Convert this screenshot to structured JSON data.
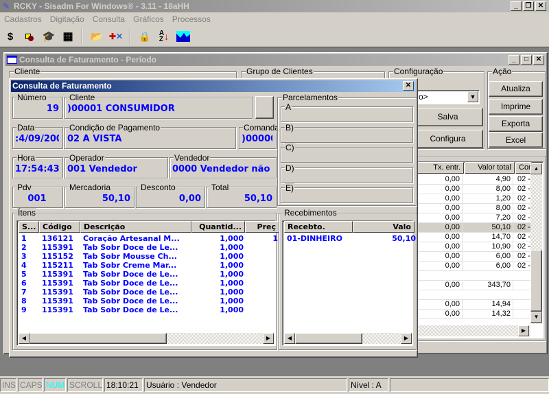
{
  "app": {
    "title": "RCKY - Sisadm For Windows® - 3.11 - 18aHH"
  },
  "menu": [
    "Cadastros",
    "Digitação",
    "Consulta",
    "Gráficos",
    "Processos"
  ],
  "toolbar": {
    "icons": [
      "dollar-icon",
      "shapes-icon",
      "graduation-cap-icon",
      "grid-icon",
      "open-folder-icon",
      "tools-icon",
      "lock-icon",
      "sort-az-icon",
      "area-chart-icon"
    ]
  },
  "child": {
    "title": "Consulta de Faturamento - Período",
    "groups": {
      "cliente": "Cliente",
      "grupo": "Grupo de Clientes",
      "config": "Configuração",
      "acao": "Ação"
    },
    "config": {
      "combo_value": "o>",
      "salva": "Salva",
      "configura": "Configura"
    },
    "acao": {
      "atualiza": "Atualiza",
      "imprime": "Imprime",
      "exporta": "Exporta",
      "excel": "Excel"
    },
    "grid": {
      "headers": [
        "Tx. entr.",
        "Valor total",
        "Con"
      ],
      "selected_row": 5,
      "rows": [
        [
          "0,00",
          "4,90",
          "02 -"
        ],
        [
          "0,00",
          "8,00",
          "02 -"
        ],
        [
          "0,00",
          "1,20",
          "02 -"
        ],
        [
          "0,00",
          "8,00",
          "02 -"
        ],
        [
          "0,00",
          "7,20",
          "02 -"
        ],
        [
          "0,00",
          "50,10",
          "02 -"
        ],
        [
          "0,00",
          "14,70",
          "02 -"
        ],
        [
          "0,00",
          "10,90",
          "02 -"
        ],
        [
          "0,00",
          "6,00",
          "02 -"
        ],
        [
          "0,00",
          "6,00",
          "02 -"
        ],
        [
          "",
          "",
          ""
        ],
        [
          "0,00",
          "343,70",
          ""
        ],
        [
          "",
          "",
          ""
        ],
        [
          "0,00",
          "14,94",
          ""
        ],
        [
          "0,00",
          "14,32",
          ""
        ]
      ]
    }
  },
  "dialog": {
    "title": "Consulta de Faturamento",
    "numero": {
      "label": "Número",
      "value": "19"
    },
    "cliente": {
      "label": "Cliente",
      "value": ")00001 CONSUMIDOR"
    },
    "data": {
      "label": "Data",
      "value": ":4/09/200:"
    },
    "condicao": {
      "label": "Condição de Pagamento",
      "value": "02 À VISTA"
    },
    "comanda": {
      "label": "Comanda",
      "value": ")00000"
    },
    "hora": {
      "label": "Hora",
      "value": "17:54:43"
    },
    "operador": {
      "label": "Operador",
      "value": "001  Vendedor"
    },
    "vendedor": {
      "label": "Vendedor",
      "value": "0000 Vendedor não"
    },
    "pdv": {
      "label": "Pdv",
      "value": "001"
    },
    "mercadoria": {
      "label": "Mercadoria",
      "value": "50,10"
    },
    "desconto": {
      "label": "Desconto",
      "value": "0,00"
    },
    "total": {
      "label": "Total",
      "value": "50,10"
    },
    "parcelamentos": {
      "label": "Parcelamentos",
      "items": [
        "A",
        "B)",
        "C)",
        "D)",
        "E)"
      ]
    },
    "itens": {
      "label": "Ítens",
      "headers": [
        "S...",
        "Código",
        "Descrição",
        "Quantid...",
        "Preç"
      ],
      "rows": [
        [
          "1",
          "136121",
          "Coração Artesanal M...",
          "1,000",
          "1"
        ],
        [
          "2",
          "115391",
          "Tab Sobr Doce de Le...",
          "1,000",
          ""
        ],
        [
          "3",
          "115152",
          "Tab Sobr Mousse Ch...",
          "1,000",
          ""
        ],
        [
          "4",
          "115211",
          "Tab Sobr Creme Mar...",
          "1,000",
          ""
        ],
        [
          "5",
          "115391",
          "Tab Sobr Doce de Le...",
          "1,000",
          ""
        ],
        [
          "6",
          "115391",
          "Tab Sobr Doce de Le...",
          "1,000",
          ""
        ],
        [
          "7",
          "115391",
          "Tab Sobr Doce de Le...",
          "1,000",
          ""
        ],
        [
          "8",
          "115391",
          "Tab Sobr Doce de Le...",
          "1,000",
          ""
        ],
        [
          "9",
          "115391",
          "Tab Sobr Doce de Le...",
          "1,000",
          ""
        ]
      ]
    },
    "recebimentos": {
      "label": "Recebimentos",
      "headers": [
        "Recebto.",
        "Valo"
      ],
      "rows": [
        [
          "01-DINHEIRO",
          "50,10"
        ]
      ]
    }
  },
  "statusbar": {
    "ins": "INS",
    "caps": "CAPS",
    "num": "NUM",
    "scroll": "SCROLL",
    "time": "18:10:21",
    "user": "Usuário : Vendedor",
    "nivel": "Nível : A",
    "num_color": "#00ffff"
  }
}
